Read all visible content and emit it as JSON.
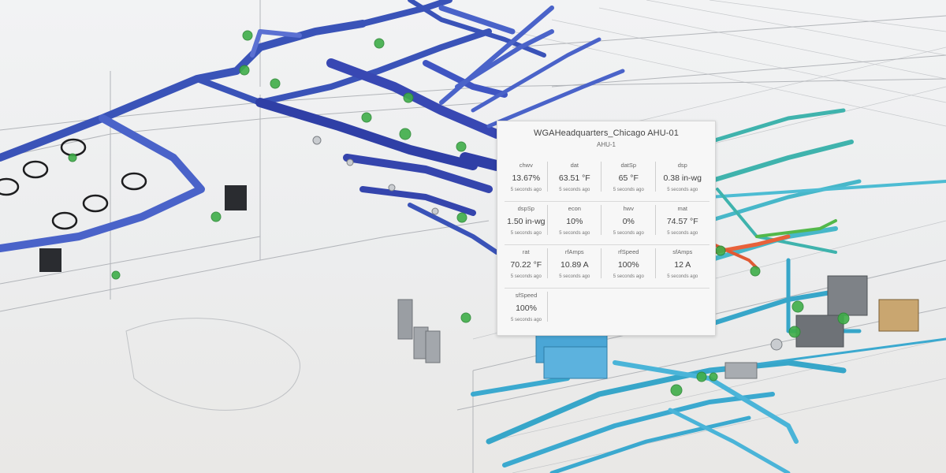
{
  "popup": {
    "title": "WGAHeadquarters_Chicago AHU-01",
    "subtitle": "AHU-1",
    "rows": [
      [
        {
          "name": "chwv",
          "value": "13.67%",
          "time": "5 seconds ago"
        },
        {
          "name": "dat",
          "value": "63.51 °F",
          "time": "5 seconds ago"
        },
        {
          "name": "datSp",
          "value": "65 °F",
          "time": "5 seconds ago"
        },
        {
          "name": "dsp",
          "value": "0.38 in-wg",
          "time": "5 seconds ago"
        }
      ],
      [
        {
          "name": "dspSp",
          "value": "1.50 in-wg",
          "time": "5 seconds ago"
        },
        {
          "name": "econ",
          "value": "10%",
          "time": "5 seconds ago"
        },
        {
          "name": "hwv",
          "value": "0%",
          "time": "5 seconds ago"
        },
        {
          "name": "mat",
          "value": "74.57 °F",
          "time": "5 seconds ago"
        }
      ],
      [
        {
          "name": "rat",
          "value": "70.22 °F",
          "time": "5 seconds ago"
        },
        {
          "name": "rfAmps",
          "value": "10.89 A",
          "time": "5 seconds ago"
        },
        {
          "name": "rfSpeed",
          "value": "100%",
          "time": "5 seconds ago"
        },
        {
          "name": "sfAmps",
          "value": "12 A",
          "time": "5 seconds ago"
        }
      ],
      [
        {
          "name": "sfSpeed",
          "value": "100%",
          "time": "5 seconds ago"
        }
      ]
    ]
  },
  "colors": {
    "supply_duct": "#3a53b8",
    "supply_duct_dark": "#2c3a9a",
    "return_duct": "#37a6c9",
    "teal_pipe": "#3fb3ad",
    "hot_pipe": "#e8613a",
    "sensor_marker": "#3fae49",
    "equipment": "#4aa6d6",
    "wireframe": "#9a9ea3"
  }
}
